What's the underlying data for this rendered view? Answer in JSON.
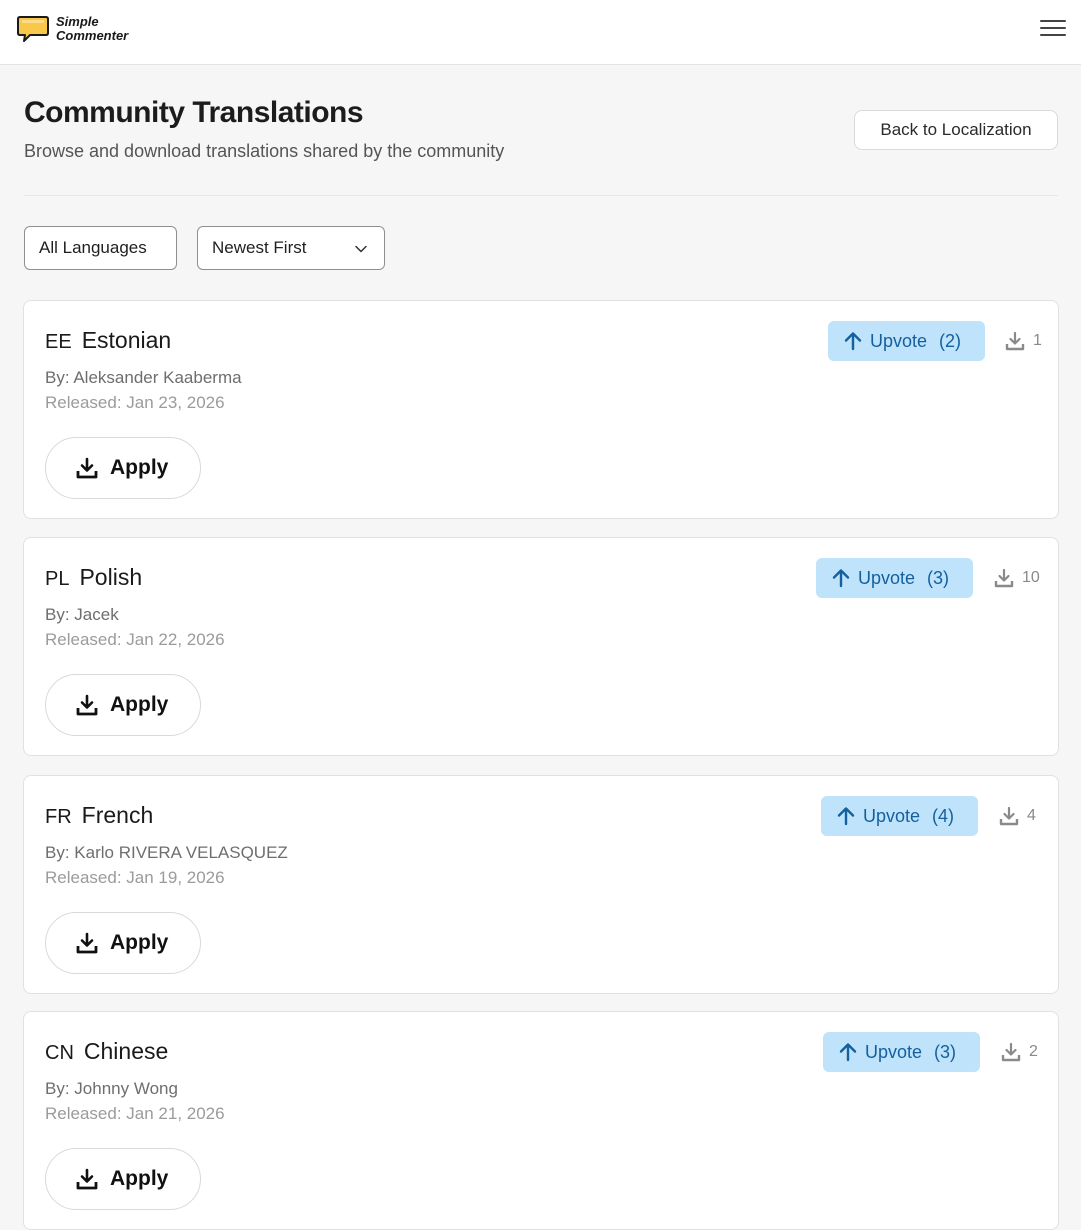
{
  "app": {
    "logo_line1": "Simple",
    "logo_line2": "Commenter"
  },
  "header": {
    "title": "Community Translations",
    "subtitle": "Browse and download translations shared by the community",
    "back_label": "Back to Localization"
  },
  "filters": {
    "language": "All Languages",
    "sort": "Newest First"
  },
  "translations": [
    {
      "code": "EE",
      "name": "Estonian",
      "author": "By: Aleksander Kaaberma",
      "released": "Released: Jan 23, 2026",
      "upvote_label": "Upvote",
      "upvotes": "(2)",
      "downloads": "1",
      "apply_label": "Apply"
    },
    {
      "code": "PL",
      "name": "Polish",
      "author": "By: Jacek",
      "released": "Released: Jan 22, 2026",
      "upvote_label": "Upvote",
      "upvotes": "(3)",
      "downloads": "10",
      "apply_label": "Apply"
    },
    {
      "code": "FR",
      "name": "French",
      "author": "By: Karlo RIVERA VELASQUEZ",
      "released": "Released: Jan 19, 2026",
      "upvote_label": "Upvote",
      "upvotes": "(4)",
      "downloads": "4",
      "apply_label": "Apply"
    },
    {
      "code": "CN",
      "name": "Chinese",
      "author": "By: Johnny Wong",
      "released": "Released: Jan 21, 2026",
      "upvote_label": "Upvote",
      "upvotes": "(3)",
      "downloads": "2",
      "apply_label": "Apply"
    }
  ],
  "colors": {
    "accent_bg": "#bfe3fb",
    "accent_text": "#15609e",
    "logo_yellow": "#f8c84a"
  },
  "icons": {
    "menu": "hamburger-icon",
    "upvote": "arrow-up-icon",
    "download": "download-icon",
    "apply": "download-icon",
    "sort": "chevron-down-icon"
  }
}
